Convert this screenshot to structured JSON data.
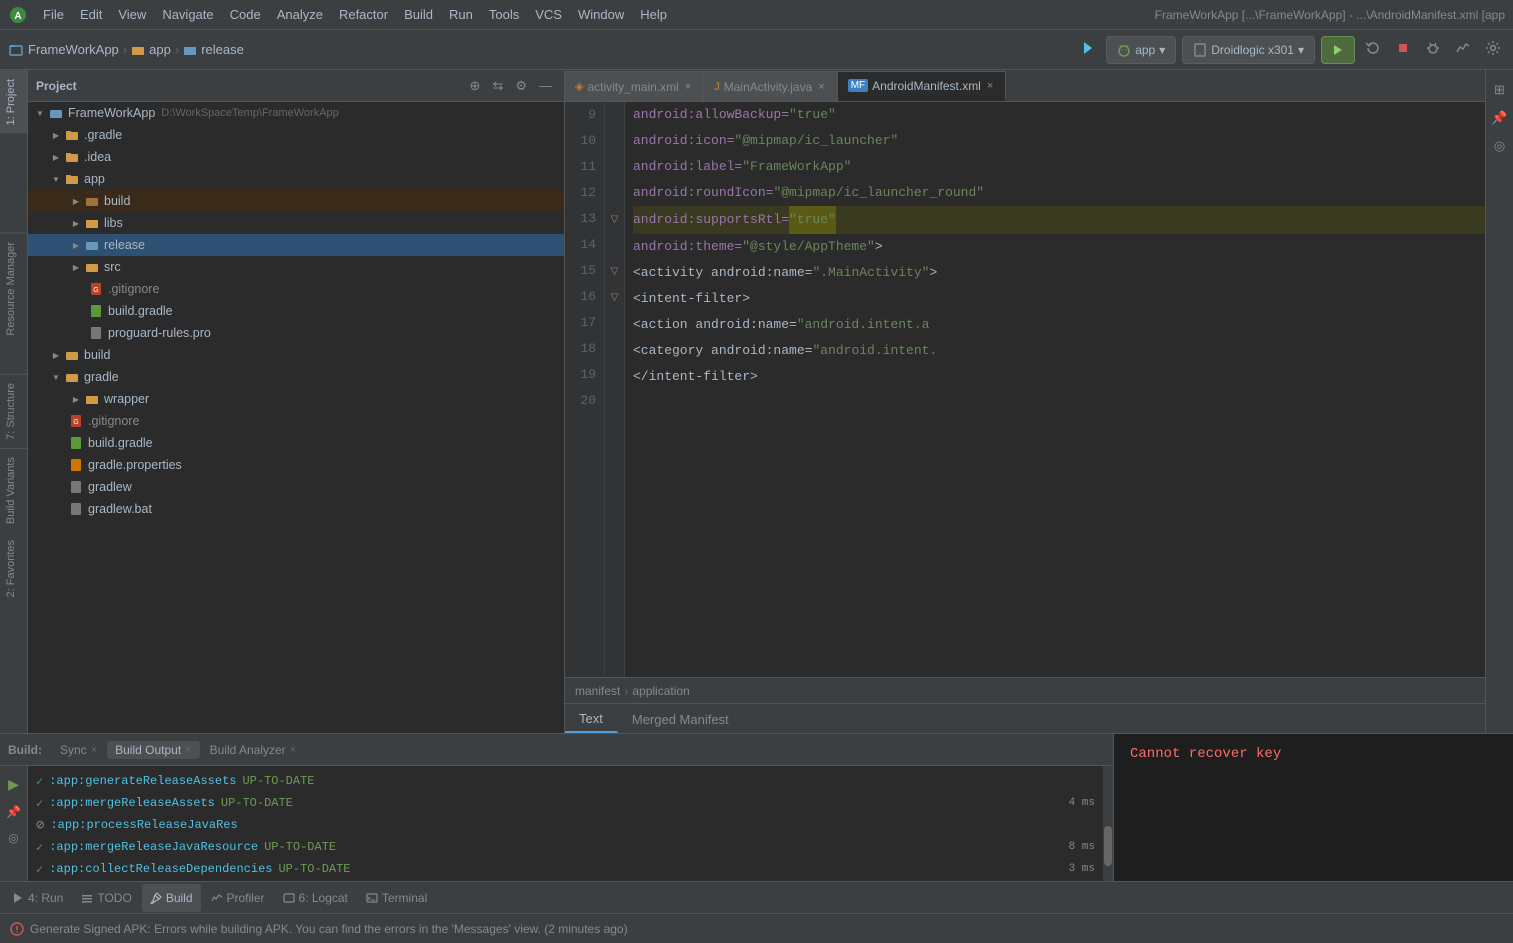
{
  "app": {
    "title": "FrameWorkApp [...\\FrameWorkApp] - ...\\AndroidManifest.xml [app",
    "logo_color": "#3d8b3d"
  },
  "menu": {
    "items": [
      "File",
      "Edit",
      "View",
      "Navigate",
      "Code",
      "Analyze",
      "Refactor",
      "Build",
      "Run",
      "Tools",
      "VCS",
      "Window",
      "Help"
    ]
  },
  "toolbar": {
    "breadcrumb": [
      "FrameWorkApp",
      "app",
      "release"
    ],
    "device_dropdown": "app",
    "emulator_dropdown": "Droidlogic x301"
  },
  "file_tree": {
    "header_title": "Project",
    "root": {
      "name": "FrameWorkApp",
      "path": "D:\\WorkSpaceTemp\\FrameWorkApp",
      "children": [
        {
          "name": ".gradle",
          "type": "folder_orange",
          "expanded": false,
          "indent": 1
        },
        {
          "name": ".idea",
          "type": "folder_orange",
          "expanded": false,
          "indent": 1
        },
        {
          "name": "app",
          "type": "folder_orange",
          "expanded": true,
          "indent": 1,
          "children": [
            {
              "name": "build",
              "type": "folder_orange",
              "expanded": false,
              "indent": 2,
              "selected": false
            },
            {
              "name": "libs",
              "type": "folder_orange",
              "expanded": false,
              "indent": 2
            },
            {
              "name": "release",
              "type": "folder_blue",
              "expanded": false,
              "indent": 2,
              "selected": true
            },
            {
              "name": "src",
              "type": "folder_orange",
              "expanded": false,
              "indent": 2
            },
            {
              "name": ".gitignore",
              "type": "file_git",
              "indent": 2
            },
            {
              "name": "build.gradle",
              "type": "file_gradle",
              "indent": 2
            },
            {
              "name": "proguard-rules.pro",
              "type": "file_pro",
              "indent": 2
            }
          ]
        },
        {
          "name": "build",
          "type": "folder_orange",
          "expanded": false,
          "indent": 1
        },
        {
          "name": "gradle",
          "type": "folder_orange",
          "expanded": true,
          "indent": 1,
          "children": [
            {
              "name": "wrapper",
              "type": "folder_orange",
              "expanded": false,
              "indent": 2
            }
          ]
        },
        {
          "name": ".gitignore",
          "type": "file_git",
          "indent": 1
        },
        {
          "name": "build.gradle",
          "type": "file_gradle",
          "indent": 1
        },
        {
          "name": "gradle.properties",
          "type": "file_prop",
          "indent": 1
        },
        {
          "name": "gradlew",
          "type": "file_plain",
          "indent": 1
        },
        {
          "name": "gradlew.bat",
          "type": "file_plain",
          "indent": 1
        }
      ]
    }
  },
  "editor_tabs": [
    {
      "name": "activity_main.xml",
      "type": "xml",
      "active": false
    },
    {
      "name": "MainActivity.java",
      "type": "java",
      "active": false
    },
    {
      "name": "AndroidManifest.xml",
      "type": "mf",
      "active": true
    }
  ],
  "code_lines": [
    {
      "num": 9,
      "gutter": "",
      "content": [
        {
          "t": "    android:allowBackup=",
          "c": "c-attr"
        },
        {
          "t": "\"true\"",
          "c": "c-val"
        }
      ]
    },
    {
      "num": 10,
      "gutter": "",
      "content": [
        {
          "t": "    android:icon=",
          "c": "c-attr"
        },
        {
          "t": "\"@mipmap/ic_launcher\"",
          "c": "c-val"
        }
      ]
    },
    {
      "num": 11,
      "gutter": "",
      "content": [
        {
          "t": "    android:label=",
          "c": "c-attr"
        },
        {
          "t": "\"FrameWorkApp\"",
          "c": "c-val"
        }
      ]
    },
    {
      "num": 12,
      "gutter": "",
      "content": [
        {
          "t": "    android:roundIcon=",
          "c": "c-attr"
        },
        {
          "t": "\"@mipmap/ic_launcher_round\"",
          "c": "c-val"
        }
      ]
    },
    {
      "num": 13,
      "gutter": "fold",
      "content": [
        {
          "t": "    android:supportsRtl=",
          "c": "c-attr"
        },
        {
          "t": "\"true\"",
          "c": "c-val c-yellow-bg"
        }
      ]
    },
    {
      "num": 14,
      "gutter": "",
      "content": [
        {
          "t": "    android:theme=",
          "c": "c-attr"
        },
        {
          "t": "\"@style/AppTheme\"",
          "c": "c-val"
        },
        {
          "t": ">",
          "c": "c-text"
        }
      ]
    },
    {
      "num": 15,
      "gutter": "fold",
      "content": [
        {
          "t": "    <activity android:name=",
          "c": "c-text"
        },
        {
          "t": "\".MainActivity\"",
          "c": "c-val"
        },
        {
          "t": ">",
          "c": "c-text"
        }
      ]
    },
    {
      "num": 16,
      "gutter": "fold",
      "content": [
        {
          "t": "        <intent-filter>",
          "c": "c-text"
        }
      ]
    },
    {
      "num": 17,
      "gutter": "",
      "content": [
        {
          "t": "            <action android:name=",
          "c": "c-text"
        },
        {
          "t": "\"android.intent.a",
          "c": "c-text"
        }
      ]
    },
    {
      "num": 18,
      "gutter": "",
      "content": []
    },
    {
      "num": 19,
      "gutter": "",
      "content": [
        {
          "t": "            <category android:name=",
          "c": "c-text"
        },
        {
          "t": "\"android.intent.",
          "c": "c-text"
        }
      ]
    },
    {
      "num": 20,
      "gutter": "",
      "content": [
        {
          "t": "        </intent-filter>",
          "c": "c-text"
        }
      ]
    }
  ],
  "editor_breadcrumb": {
    "parts": [
      "manifest",
      "application"
    ]
  },
  "editor_bottom_tabs": [
    {
      "name": "Text",
      "active": true
    },
    {
      "name": "Merged Manifest",
      "active": false
    }
  ],
  "build_panel": {
    "build_label": "Build:",
    "tabs": [
      {
        "name": "Sync",
        "active": false,
        "closeable": true
      },
      {
        "name": "Build Output",
        "active": true,
        "closeable": true
      },
      {
        "name": "Build Analyzer",
        "active": false,
        "closeable": true
      }
    ],
    "items": [
      {
        "status": "success",
        "task": ":app:generateReleaseAssets",
        "tag": "UP-TO-DATE",
        "time": ""
      },
      {
        "status": "success",
        "task": ":app:mergeReleaseAssets",
        "tag": "UP-TO-DATE",
        "time": "4 ms"
      },
      {
        "status": "skip",
        "task": ":app:processReleaseJavaRes",
        "tag": "",
        "time": ""
      },
      {
        "status": "success",
        "task": ":app:mergeReleaseJavaResource",
        "tag": "UP-TO-DATE",
        "time": "8 ms"
      },
      {
        "status": "success",
        "task": ":app:collectReleaseDependencies",
        "tag": "UP-TO-DATE",
        "time": "3 ms"
      }
    ],
    "error_message": "Cannot recover key"
  },
  "status_bar": {
    "message": "Generate Signed APK: Errors while building APK. You can find the errors in the 'Messages' view. (2 minutes ago)"
  },
  "bottom_tools": [
    {
      "name": "Run",
      "num": "4",
      "active": false
    },
    {
      "name": "TODO",
      "num": "",
      "active": false
    },
    {
      "name": "Build",
      "num": "",
      "active": true
    },
    {
      "name": "Profiler",
      "num": "",
      "active": false
    },
    {
      "name": "Logcat",
      "num": "6",
      "active": false
    },
    {
      "name": "Terminal",
      "num": "",
      "active": false
    }
  ],
  "side_panel_labels": [
    {
      "name": "1: Project",
      "active": true
    },
    {
      "name": "7: Structure",
      "active": false
    },
    {
      "name": "Build Variants",
      "active": false
    },
    {
      "name": "2: Favorites",
      "active": false
    }
  ],
  "right_side_labels": [
    {
      "name": "Resource Manager",
      "active": false
    }
  ]
}
